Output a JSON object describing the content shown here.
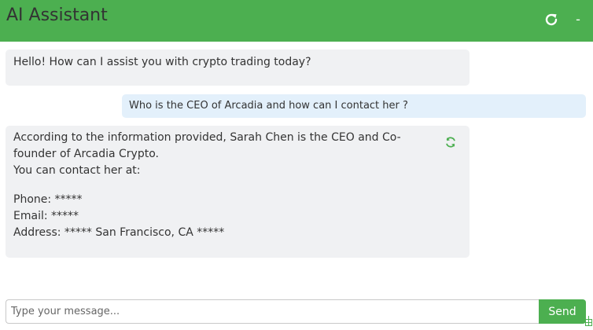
{
  "header": {
    "title": "AI Assistant",
    "refresh_icon": "refresh-icon",
    "minimize_label": "-",
    "background_color": "#4caf50"
  },
  "messages": [
    {
      "role": "assistant",
      "lines": [
        "Hello! How can I assist you with crypto trading today?"
      ]
    },
    {
      "role": "user",
      "text": "Who is the CEO of Arcadia and how can I contact her ?"
    },
    {
      "role": "assistant",
      "lines": [
        "According to the information provided, Sarah Chen is the CEO and Co-",
        "founder of Arcadia Crypto.",
        "You can contact her at:",
        "Phone: *****",
        "Email: *****",
        "Address: ***** San Francisco, CA *****"
      ],
      "regenerate_icon": "regenerate-icon"
    }
  ],
  "composer": {
    "placeholder": "Type your message...",
    "value": "",
    "send_label": "Send"
  },
  "colors": {
    "accent": "#4caf50",
    "bot_bubble": "#f0f1f3",
    "user_bubble": "#e3f0fb"
  }
}
